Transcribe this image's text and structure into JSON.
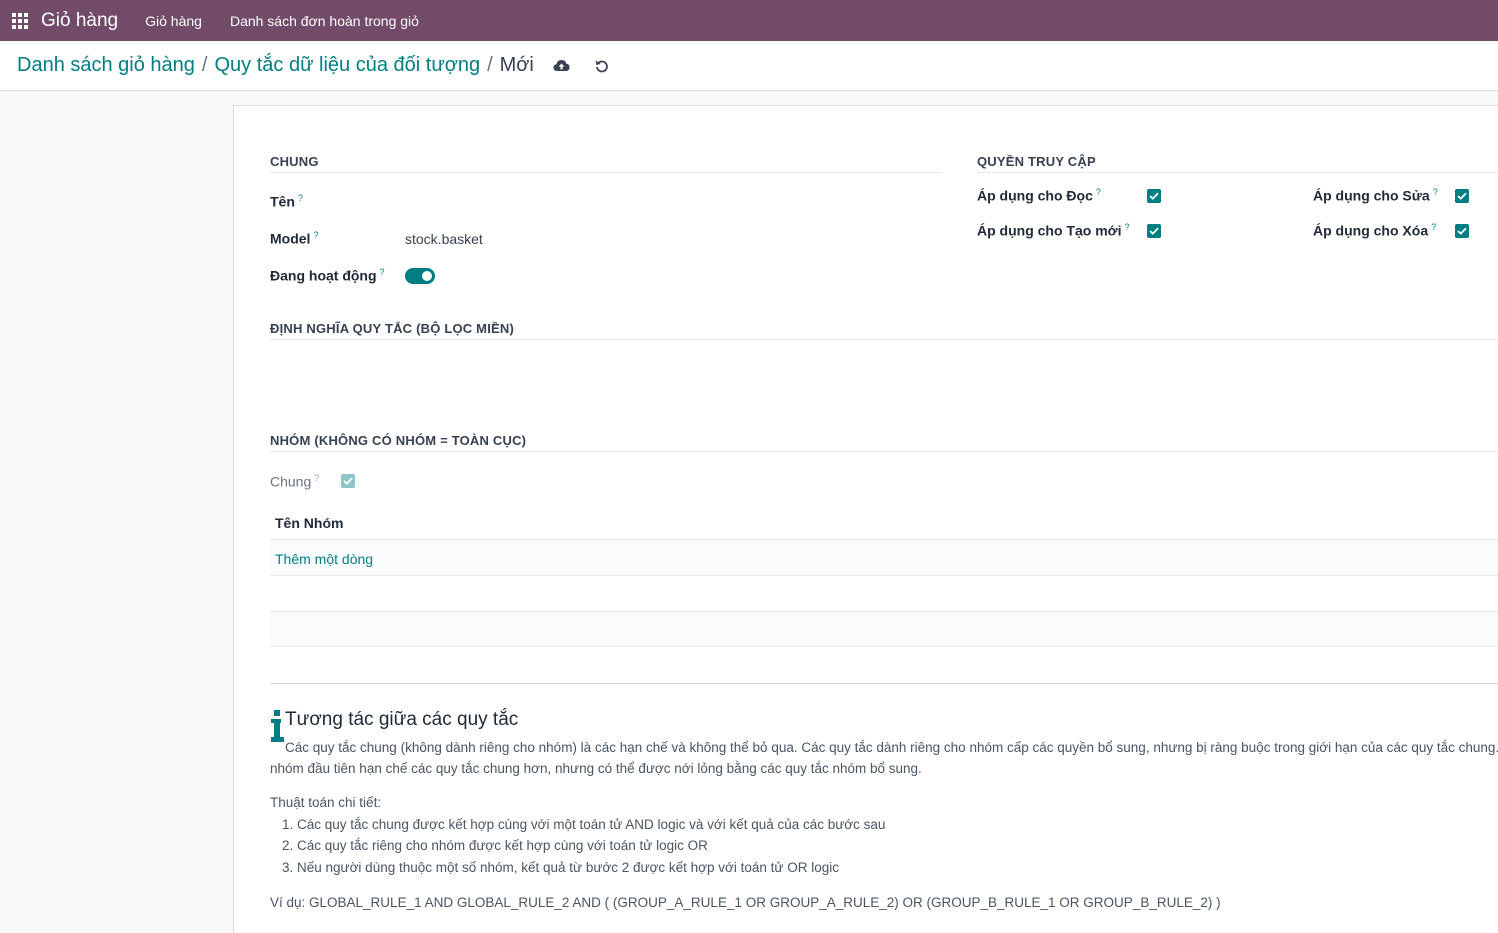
{
  "navbar": {
    "brand": "Giỏ hàng",
    "items": [
      "Giỏ hàng",
      "Danh sách đơn hoàn trong giỏ"
    ]
  },
  "breadcrumb": {
    "items": [
      "Danh sách giỏ hàng",
      "Quy tắc dữ liệu của đối tượng"
    ],
    "separator": "/",
    "current": "Mới"
  },
  "general": {
    "title": "CHUNG",
    "name_label": "Tên",
    "name_value": "",
    "model_label": "Model",
    "model_value": "stock.basket",
    "active_label": "Đang hoạt động",
    "active": true
  },
  "access": {
    "title": "QUYỀN TRUY CẬP",
    "read_label": "Áp dụng cho Đọc",
    "write_label": "Áp dụng cho Sửa",
    "create_label": "Áp dụng cho Tạo mới",
    "unlink_label": "Áp dụng cho Xóa",
    "read": true,
    "write": true,
    "create": true,
    "unlink": true
  },
  "domain_section": {
    "title": "ĐỊNH NGHĨA QUY TẮC (BỘ LỌC MIỀN)"
  },
  "groups": {
    "title": "NHÓM (KHÔNG CÓ NHÓM = TOÀN CỤC)",
    "global_label": "Chung",
    "global": true,
    "column_header": "Tên Nhóm",
    "add_line": "Thêm một dòng"
  },
  "help": {
    "title": "Tương tác giữa các quy tắc",
    "para1_line1": "Các quy tắc chung (không dành riêng cho nhóm) là các hạn chế và không thể bỏ qua. Các quy tắc dành riêng cho nhóm cấp các quyền bổ sung, nhưng bị ràng buộc trong giới hạn của các quy tắc chung.",
    "para1_line2": "nhóm đầu tiên hạn chế các quy tắc chung hơn, nhưng có thể được nới lỏng bằng các quy tắc nhóm bổ sung.",
    "algo_title": "Thuật toán chi tiết:",
    "steps": [
      "1. Các quy tắc chung được kết hợp cùng với một toán tử AND logic và với kết quả của các bước sau",
      "2. Các quy tắc riêng cho nhóm được kết hợp cùng với toán tử logic OR",
      "3. Nếu người dùng thuộc một số nhóm, kết quả từ bước 2 được kết hợp với toán tử OR logic"
    ],
    "example": "Ví dụ: GLOBAL_RULE_1 AND GLOBAL_RULE_2 AND ( (GROUP_A_RULE_1 OR GROUP_A_RULE_2) OR (GROUP_B_RULE_1 OR GROUP_B_RULE_2) )"
  },
  "colors": {
    "navbar": "#714b67",
    "accent": "#017e84"
  }
}
